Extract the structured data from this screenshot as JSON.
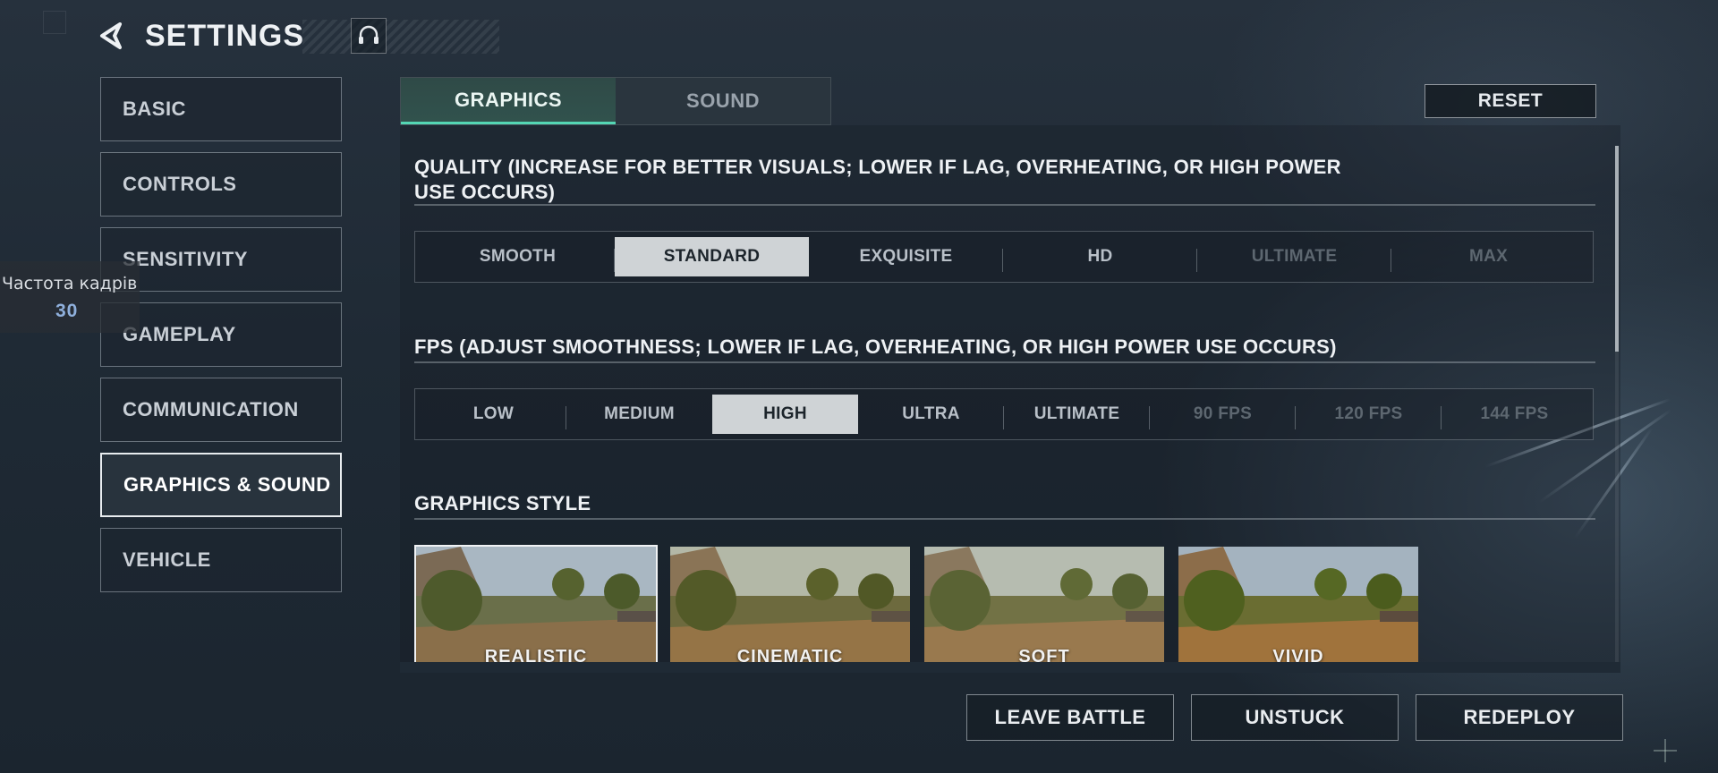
{
  "header": {
    "title": "SETTINGS",
    "back_icon": "back-arrow-icon",
    "voice_icon": "headset-icon"
  },
  "sidebar": {
    "items": [
      {
        "label": "BASIC",
        "active": false
      },
      {
        "label": "CONTROLS",
        "active": false
      },
      {
        "label": "SENSITIVITY",
        "active": false
      },
      {
        "label": "GAMEPLAY",
        "active": false
      },
      {
        "label": "COMMUNICATION",
        "active": false
      },
      {
        "label": "GRAPHICS & SOUND",
        "active": true
      },
      {
        "label": "VEHICLE",
        "active": false
      }
    ]
  },
  "fps_overlay": {
    "label": "Частота кадрів",
    "value": "30"
  },
  "tabs": [
    {
      "label": "GRAPHICS",
      "active": true
    },
    {
      "label": "SOUND",
      "active": false
    }
  ],
  "reset_label": "RESET",
  "quality": {
    "title_line1": "QUALITY (INCREASE FOR BETTER VISUALS; LOWER IF LAG, OVERHEATING, OR HIGH POWER",
    "title_line2": "USE OCCURS)",
    "options": [
      "SMOOTH",
      "STANDARD",
      "EXQUISITE",
      "HD",
      "ULTIMATE",
      "MAX"
    ],
    "selected": "STANDARD",
    "disabled": [
      "ULTIMATE",
      "MAX"
    ]
  },
  "fps": {
    "title": "FPS (ADJUST SMOOTHNESS; LOWER IF LAG, OVERHEATING, OR HIGH POWER USE OCCURS)",
    "options": [
      "LOW",
      "MEDIUM",
      "HIGH",
      "ULTRA",
      "ULTIMATE",
      "90 FPS",
      "120 FPS",
      "144 FPS"
    ],
    "selected": "HIGH",
    "disabled": [
      "90 FPS",
      "120 FPS",
      "144 FPS"
    ]
  },
  "graphics_style": {
    "title": "GRAPHICS STYLE",
    "styles": [
      {
        "label": "REALISTIC",
        "selected": true
      },
      {
        "label": "CINEMATIC",
        "selected": false
      },
      {
        "label": "SOFT",
        "selected": false
      },
      {
        "label": "VIVID",
        "selected": false
      }
    ]
  },
  "bottom_buttons": [
    "LEAVE BATTLE",
    "UNSTUCK",
    "REDEPLOY"
  ],
  "colors": {
    "accent": "#54d6b4",
    "selected_option_bg": "#cfd3d6",
    "fps_value": "#8fb0dc"
  }
}
